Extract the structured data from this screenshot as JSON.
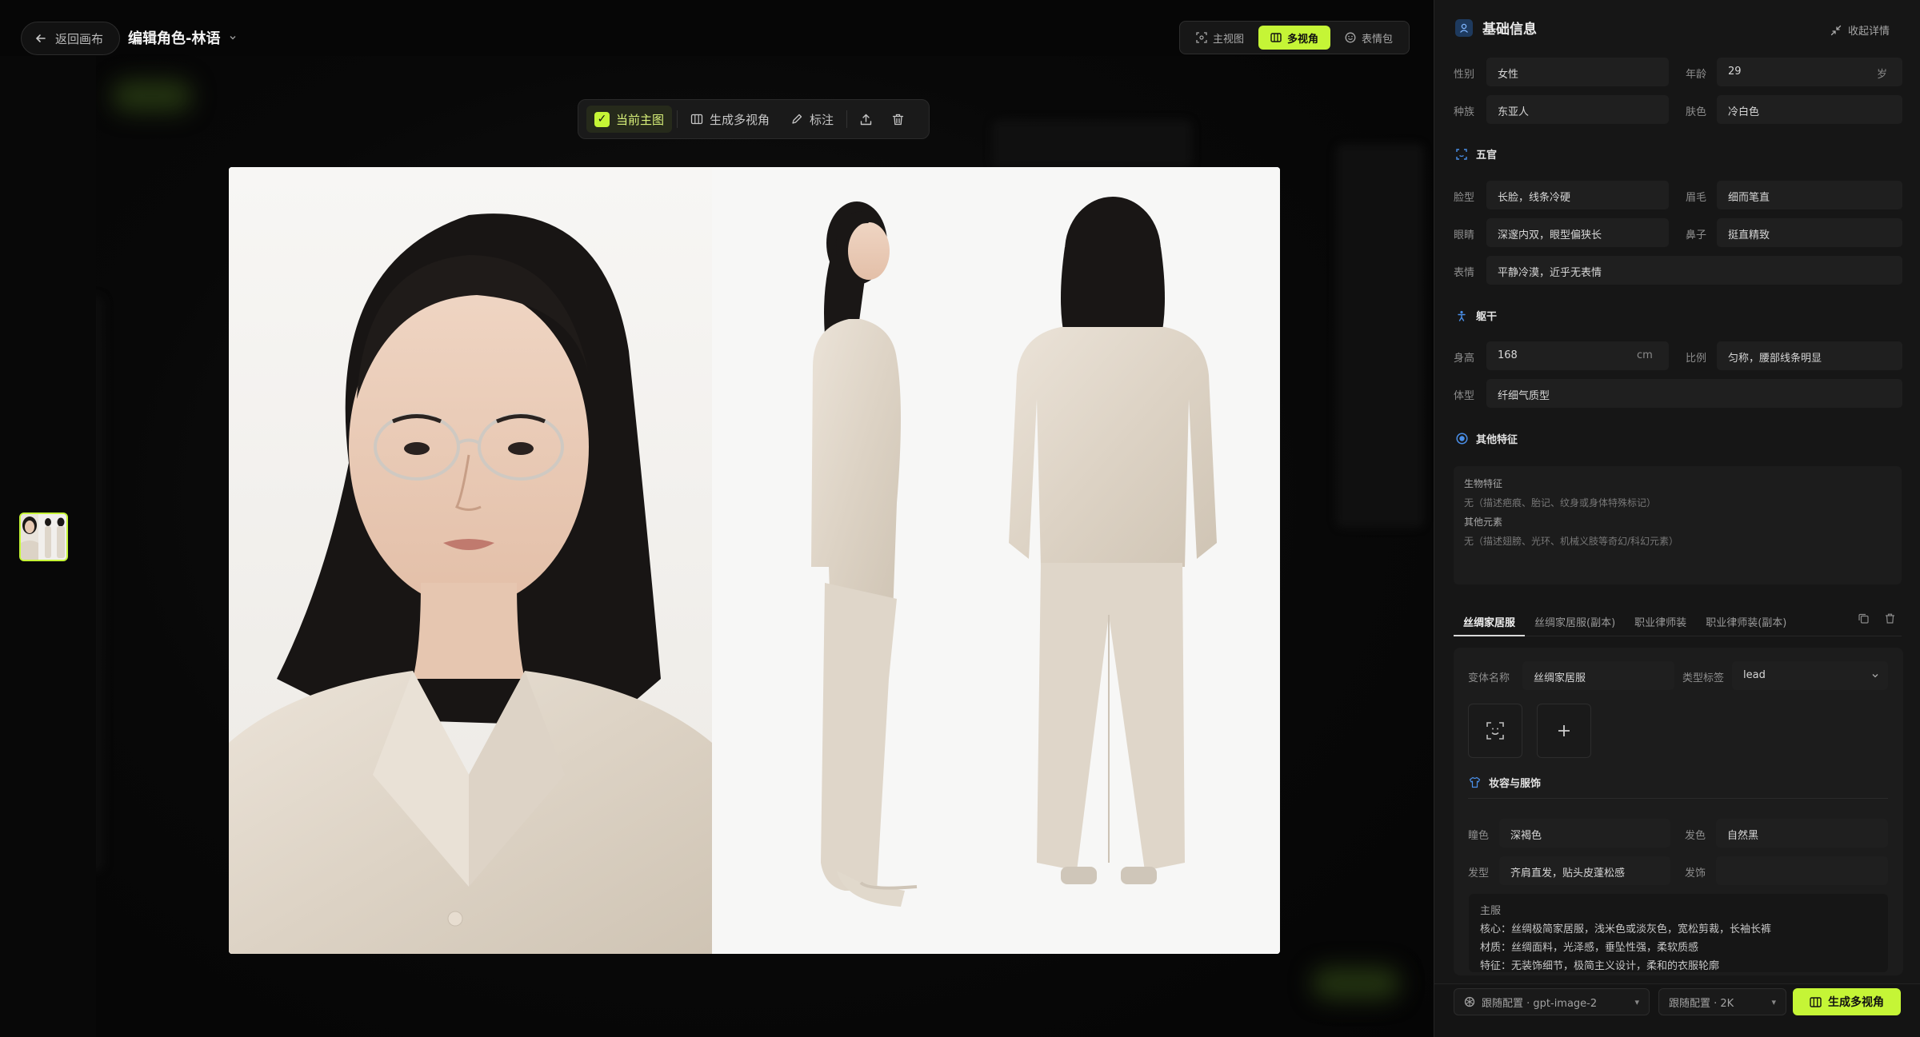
{
  "header": {
    "back_label": "返回画布",
    "page_title": "编辑角色-林语",
    "views": [
      {
        "label": "主视图"
      },
      {
        "label": "多视角"
      },
      {
        "label": "表情包"
      }
    ]
  },
  "image_toolbar": {
    "current_main": "当前主图",
    "generate_multiview": "生成多视角",
    "annotate": "标注"
  },
  "panel": {
    "title": "基础信息",
    "collapse_label": "收起详情",
    "basic": {
      "gender_label": "性别",
      "gender": "女性",
      "age_label": "年龄",
      "age": "29",
      "age_unit": "岁",
      "ethnicity_label": "种族",
      "ethnicity": "东亚人",
      "skin_label": "肤色",
      "skin": "冷白色"
    },
    "features": {
      "title": "五官",
      "face_label": "脸型",
      "face": "长脸，线条冷硬",
      "brow_label": "眉毛",
      "brow": "细而笔直",
      "eyes_label": "眼睛",
      "eyes": "深邃内双，眼型偏狭长",
      "nose_label": "鼻子",
      "nose": "挺直精致",
      "expr_label": "表情",
      "expr": "平静冷漠，近乎无表情"
    },
    "body": {
      "title": "躯干",
      "height_label": "身高",
      "height": "168",
      "height_unit": "cm",
      "ratio_label": "比例",
      "ratio": "匀称，腰部线条明显",
      "build_label": "体型",
      "build": "纤细气质型"
    },
    "other": {
      "title": "其他特征",
      "bio_label": "生物特征",
      "bio_value": "无（描述疤痕、胎记、纹身或身体特殊标记）",
      "extra_label": "其他元素",
      "extra_value": "无（描述翅膀、光环、机械义肢等奇幻/科幻元素）"
    },
    "tabs": [
      "丝绸家居服",
      "丝绸家居服(副本)",
      "职业律师装",
      "职业律师装(副本)"
    ],
    "variant": {
      "name_label": "变体名称",
      "name": "丝绸家居服",
      "type_label": "类型标签",
      "type": "lead",
      "makeup_title": "妆容与服饰",
      "pupil_label": "瞳色",
      "pupil": "深褐色",
      "hair_color_label": "发色",
      "hair_color": "自然黑",
      "hairstyle_label": "发型",
      "hairstyle": "齐肩直发，贴头皮蓬松感",
      "hair_acc_label": "发饰",
      "hair_acc": "",
      "outfit_label": "主服",
      "outfit_core": "核心：丝绸极简家居服，浅米色或淡灰色，宽松剪裁，长袖长裤",
      "outfit_material": "材质：丝绸面料，光泽感，垂坠性强，柔软质感",
      "outfit_feature": "特征：无装饰细节，极简主义设计，柔和的衣服轮廓"
    },
    "footer": {
      "model_select": "跟随配置 · gpt-image-2",
      "res_select": "跟随配置 · 2K",
      "generate_label": "生成多视角"
    }
  },
  "colors": {
    "accent": "#c5f536",
    "panel_bg": "#161616",
    "field_bg": "#1f1f1f"
  }
}
